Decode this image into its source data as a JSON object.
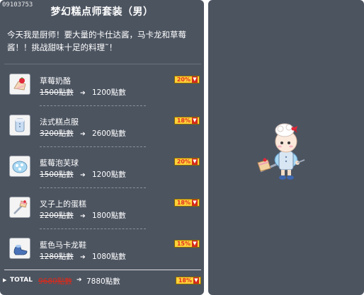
{
  "item_code": "09103753",
  "title": "梦幻糕点师套装（男）",
  "description": "今天我是厨师！要大量的卡仕达酱，马卡龙和草莓酱！！挑战甜味十足的料理˜！",
  "items": [
    {
      "name": "草莓奶酪",
      "old_price": "1500點數",
      "new_price": "1200點數",
      "discount": "20%",
      "icon": "strawberry-cheese-hat-icon"
    },
    {
      "name": "法式糕点服",
      "old_price": "3200點數",
      "new_price": "2600點數",
      "discount": "18%",
      "icon": "pastry-chef-outfit-icon"
    },
    {
      "name": "藍莓泡芙球",
      "old_price": "1500點數",
      "new_price": "1200點數",
      "discount": "20%",
      "icon": "blueberry-puff-cape-icon"
    },
    {
      "name": "叉子上的蛋糕",
      "old_price": "2200點數",
      "new_price": "1800點數",
      "discount": "18%",
      "icon": "cake-on-fork-weapon-icon"
    },
    {
      "name": "藍色马卡龙鞋",
      "old_price": "1280點數",
      "new_price": "1080點數",
      "discount": "15%",
      "icon": "blue-macaron-shoes-icon"
    }
  ],
  "total": {
    "label": "TOTAL",
    "old_price": "9680點數",
    "new_price": "7880點數",
    "discount": "18%"
  },
  "colors": {
    "panel_bg": "#4c5460",
    "badge_bg": "#ffd23a",
    "badge_text": "#e03020",
    "total_old_price": "#e02818"
  }
}
